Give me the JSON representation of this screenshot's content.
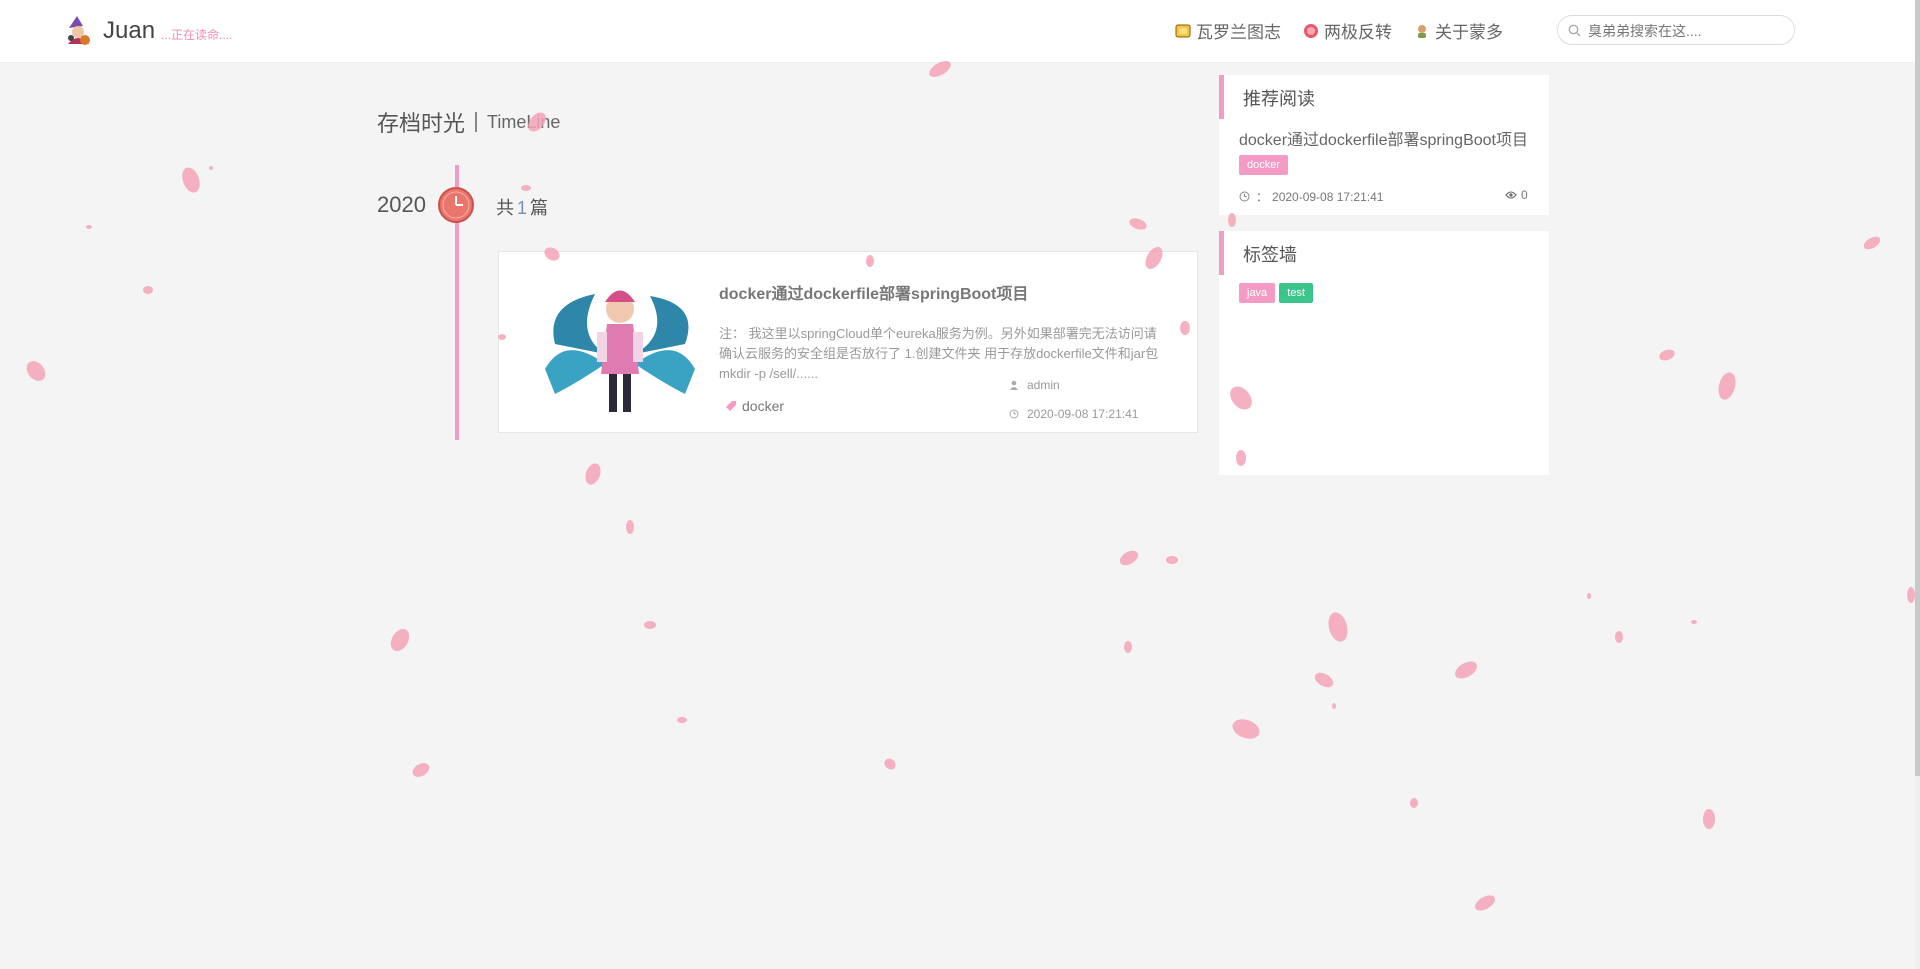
{
  "header": {
    "brand_name": "Juan",
    "brand_subtitle": "...正在读命....",
    "nav": [
      {
        "label": "瓦罗兰图志",
        "icon": "map-icon"
      },
      {
        "label": "两极反转",
        "icon": "poro-icon"
      },
      {
        "label": "关于蒙多",
        "icon": "avatar-icon"
      }
    ],
    "search_placeholder": "臭弟弟搜索在这....",
    "search_value": ""
  },
  "main": {
    "title": "存档时光",
    "subtitle": "TimeLine",
    "timeline": {
      "year": "2020",
      "count_prefix": "共",
      "count": "1",
      "count_suffix": "篇"
    },
    "posts": [
      {
        "title": "docker通过dockerfile部署springBoot项目",
        "excerpt": "注： 我这里以springCloud单个eureka服务为例。另外如果部署完无法访问请确认云服务的安全组是否放行了 1.创建文件夹 用于存放dockerfile文件和jar包 mkdir -p /sell/......",
        "tag": "docker",
        "author": "admin",
        "date": "2020-09-08 17:21:41"
      }
    ]
  },
  "sidebar": {
    "recommended": {
      "title": "推荐阅读",
      "item_title": "docker通过dockerfile部署springBoot项目",
      "tag": "docker",
      "date_label": "：",
      "date": "2020-09-08 17:21:41",
      "views": "0"
    },
    "tagwall": {
      "title": "标签墙",
      "tags": [
        {
          "label": "java",
          "color": "#f39bc5"
        },
        {
          "label": "test",
          "color": "#3bc48b"
        }
      ]
    }
  },
  "colors": {
    "accent_pink": "#f39bc5",
    "tag_green": "#3bc48b",
    "background": "#f4f4f4"
  }
}
